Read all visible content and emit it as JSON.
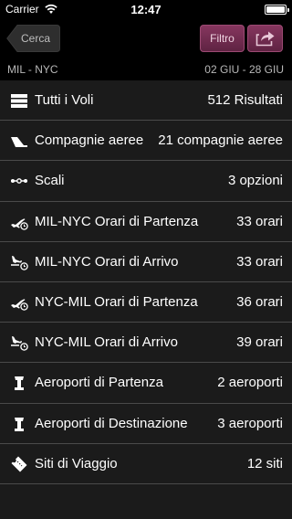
{
  "status_bar": {
    "carrier": "Carrier",
    "time": "12:47",
    "wifi_icon": "wifi-icon",
    "battery_icon": "battery-icon"
  },
  "nav": {
    "back_label": "Cerca",
    "filter_label": "Filtro",
    "share_icon": "share-icon"
  },
  "route_bar": {
    "route": "MIL - NYC",
    "dates": "02 GIU - 28 GIU"
  },
  "rows": [
    {
      "icon": "list-icon",
      "label": "Tutti i Voli",
      "value": "512 Risultati"
    },
    {
      "icon": "airline-tail-icon",
      "label": "Compagnie aeree",
      "value": "21 compagnie aeree"
    },
    {
      "icon": "stops-icon",
      "label": "Scali",
      "value": "3 opzioni"
    },
    {
      "icon": "departure-clock-icon",
      "label": "MIL-NYC Orari di Partenza",
      "value": "33 orari"
    },
    {
      "icon": "arrival-clock-icon",
      "label": "MIL-NYC Orari di Arrivo",
      "value": "33 orari"
    },
    {
      "icon": "departure-clock-icon",
      "label": "NYC-MIL Orari di Partenza",
      "value": "36 orari"
    },
    {
      "icon": "arrival-clock-icon",
      "label": "NYC-MIL Orari di Arrivo",
      "value": "39 orari"
    },
    {
      "icon": "airport-tower-icon",
      "label": "Aeroporti di Partenza",
      "value": "2 aeroporti"
    },
    {
      "icon": "airport-tower-icon",
      "label": "Aeroporti di Destinazione",
      "value": "3 aeroporti"
    },
    {
      "icon": "ticket-icon",
      "label": "Siti di Viaggio",
      "value": "12 siti"
    }
  ],
  "colors": {
    "accent": "#7a2f55",
    "background": "#1b1b1b",
    "divider": "#4a4a4a"
  }
}
